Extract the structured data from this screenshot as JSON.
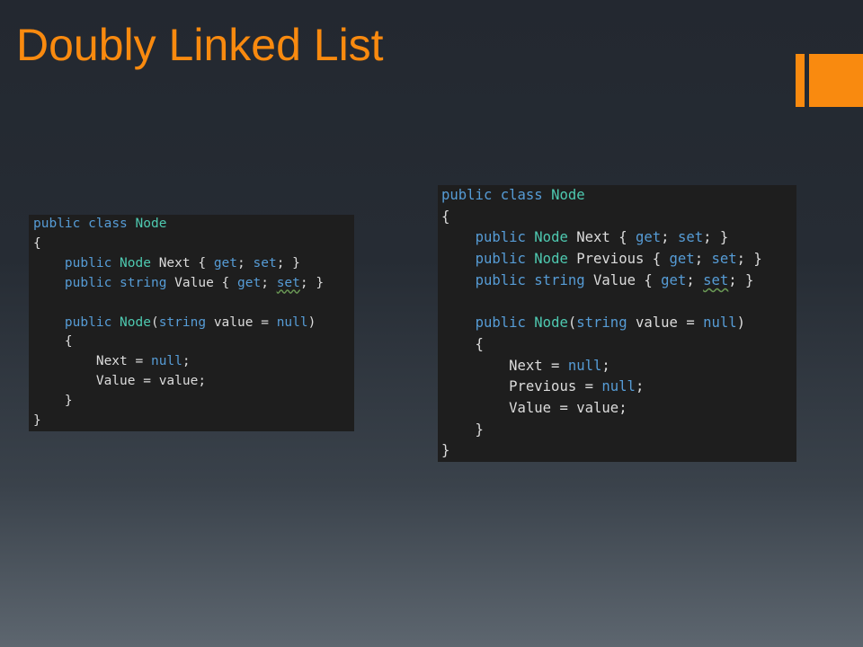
{
  "slide": {
    "title": "Doubly Linked List"
  },
  "colors": {
    "title": "#f98a0f",
    "accent": "#f98a0f",
    "background_top": "#232830",
    "background_bottom": "#5d666f",
    "code_background": "#1e1e1e",
    "code_keyword": "#569cd6",
    "code_type": "#4ec9b0",
    "code_text": "#dcdcdc"
  },
  "code_left": {
    "lines": [
      "public class Node",
      "{",
      "    public Node Next { get; set; }",
      "    public string Value { get; set; }",
      "",
      "    public Node(string value = null)",
      "    {",
      "        Next = null;",
      "        Value = value;",
      "    }",
      "}"
    ]
  },
  "code_right": {
    "lines": [
      "public class Node",
      "{",
      "    public Node Next { get; set; }",
      "    public Node Previous { get; set; }",
      "    public string Value { get; set; }",
      "",
      "    public Node(string value = null)",
      "    {",
      "        Next = null;",
      "        Previous = null;",
      "        Value = value;",
      "    }",
      "}"
    ]
  }
}
